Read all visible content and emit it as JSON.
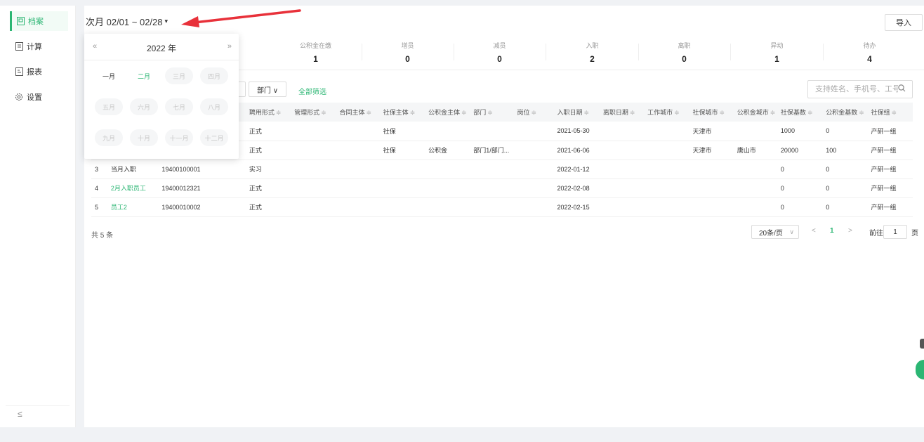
{
  "sidebar": {
    "items": [
      {
        "label": "档案",
        "icon": "archive-icon",
        "active": true
      },
      {
        "label": "计算",
        "icon": "calculator-icon",
        "active": false
      },
      {
        "label": "报表",
        "icon": "report-icon",
        "active": false
      },
      {
        "label": "设置",
        "icon": "gear-icon",
        "active": false
      }
    ],
    "collapse_icon": "≤"
  },
  "header": {
    "period_label": "次月 02/01 ~ 02/28",
    "caret": "▾",
    "import_label": "导入"
  },
  "stats": [
    {
      "label": "公积金在缴",
      "value": "1"
    },
    {
      "label": "增员",
      "value": "0"
    },
    {
      "label": "减员",
      "value": "0"
    },
    {
      "label": "入职",
      "value": "2"
    },
    {
      "label": "离职",
      "value": "0"
    },
    {
      "label": "异动",
      "value": "1"
    },
    {
      "label": "待办",
      "value": "4"
    }
  ],
  "filters": {
    "department_label": "部门 ∨",
    "all_filter_label": "全部筛选",
    "search_placeholder": "支持姓名、手机号、工号搜"
  },
  "table": {
    "headers": [
      "聘用形式",
      "管理形式",
      "合同主体",
      "社保主体",
      "公积金主体",
      "部门",
      "岗位",
      "入职日期",
      "离职日期",
      "工作城市",
      "社保城市",
      "公积金城市",
      "社保基数",
      "公积金基数",
      "社保组"
    ],
    "rows": [
      {
        "no": "",
        "name": "",
        "id": "",
        "hire": "正式",
        "mgmt": "",
        "contract": "",
        "ss_subject": "社保",
        "hf_subject": "",
        "dept": "",
        "post": "",
        "join": "2021-05-30",
        "leave": "",
        "work_city": "",
        "ss_city": "天津市",
        "hf_city": "",
        "ss_base": "1000",
        "hf_base": "0",
        "group": "产研一组"
      },
      {
        "no": "",
        "name": "",
        "id": "",
        "hire": "正式",
        "mgmt": "",
        "contract": "",
        "ss_subject": "社保",
        "hf_subject": "公积金",
        "dept": "部门1/部门...",
        "post": "",
        "join": "2021-06-06",
        "leave": "",
        "work_city": "",
        "ss_city": "天津市",
        "hf_city": "唐山市",
        "ss_base": "20000",
        "hf_base": "100",
        "group": "产研一组"
      },
      {
        "no": "3",
        "name": "当月入职",
        "id": "19400100001",
        "hire": "实习",
        "mgmt": "",
        "contract": "",
        "ss_subject": "",
        "hf_subject": "",
        "dept": "",
        "post": "",
        "join": "2022-01-12",
        "leave": "",
        "work_city": "",
        "ss_city": "",
        "hf_city": "",
        "ss_base": "0",
        "hf_base": "0",
        "group": "产研一组",
        "name_link": false
      },
      {
        "no": "4",
        "name": "2月入职员工",
        "id": "19400012321",
        "hire": "正式",
        "mgmt": "",
        "contract": "",
        "ss_subject": "",
        "hf_subject": "",
        "dept": "",
        "post": "",
        "join": "2022-02-08",
        "leave": "",
        "work_city": "",
        "ss_city": "",
        "hf_city": "",
        "ss_base": "0",
        "hf_base": "0",
        "group": "产研一组",
        "name_link": true
      },
      {
        "no": "5",
        "name": "员工2",
        "id": "19400010002",
        "hire": "正式",
        "mgmt": "",
        "contract": "",
        "ss_subject": "",
        "hf_subject": "",
        "dept": "",
        "post": "",
        "join": "2022-02-15",
        "leave": "",
        "work_city": "",
        "ss_city": "",
        "hf_city": "",
        "ss_base": "0",
        "hf_base": "0",
        "group": "产研一组",
        "name_link": true
      }
    ]
  },
  "footer": {
    "total": "共 5 条",
    "page_size": "20条/页",
    "prev": "<",
    "current_page": "1",
    "next": ">",
    "goto_label": "前往",
    "goto_value": "1",
    "page_label": "页"
  },
  "month_picker": {
    "prev": "«",
    "next": "»",
    "year": "2022 年",
    "months": [
      "一月",
      "二月",
      "三月",
      "四月",
      "五月",
      "六月",
      "七月",
      "八月",
      "九月",
      "十月",
      "十一月",
      "十二月"
    ],
    "current_index": 1,
    "enabled_count": 2
  },
  "colors": {
    "accent": "#2bb673",
    "arrow": "#e8313a"
  }
}
